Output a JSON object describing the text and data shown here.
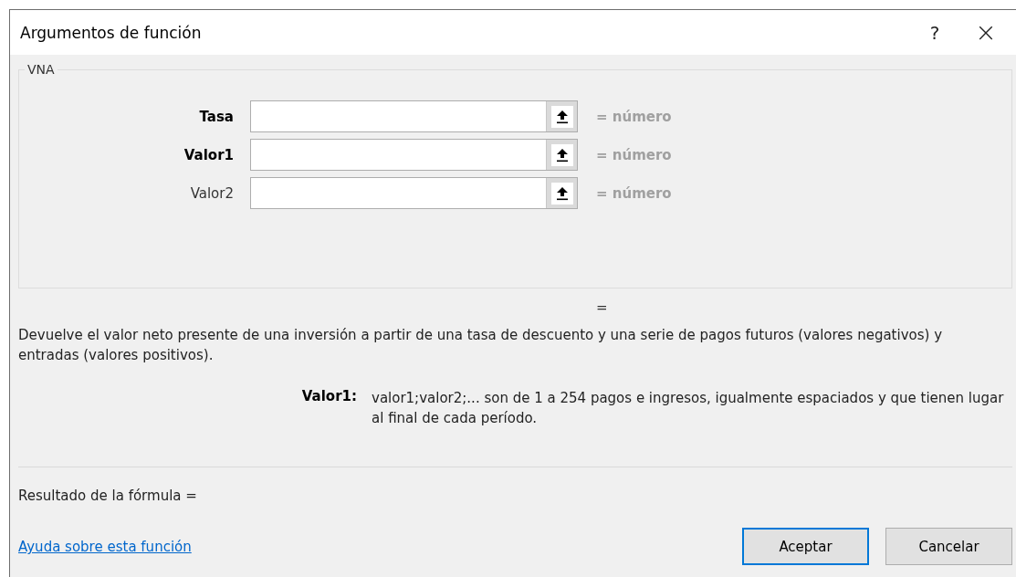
{
  "window": {
    "title": "Argumentos de función",
    "help": "?",
    "close": "×"
  },
  "function_name": "VNA",
  "arguments": [
    {
      "label": "Tasa",
      "required": true,
      "value_hint": "= número"
    },
    {
      "label": "Valor1",
      "required": true,
      "value_hint": "= número"
    },
    {
      "label": "Valor2",
      "required": false,
      "value_hint": "= número"
    }
  ],
  "function_result": "=",
  "description": "Devuelve el valor neto presente de una inversión a partir de una tasa de descuento y una serie de pagos futuros (valores negativos) y entradas (valores positivos).",
  "argument_help": {
    "label": "Valor1:",
    "text": "valor1;valor2;... son de 1 a 254 pagos e ingresos, igualmente espaciados y que tienen lugar al final de cada período."
  },
  "formula_result": "Resultado de la fórmula =",
  "help_link": "Ayuda sobre esta función",
  "buttons": [
    {
      "label": "Aceptar",
      "default": true
    },
    {
      "label": "Cancelar",
      "default": false
    }
  ]
}
